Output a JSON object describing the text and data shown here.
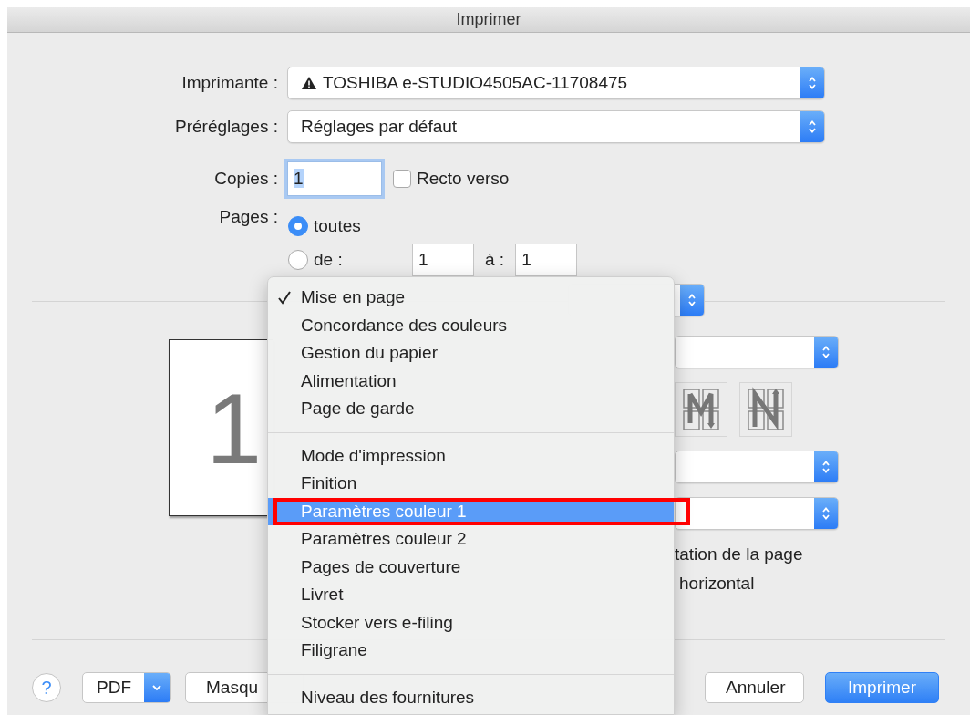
{
  "window": {
    "title": "Imprimer"
  },
  "printer": {
    "label": "Imprimante :",
    "value": "TOSHIBA e-STUDIO4505AC-11708475",
    "warning": true
  },
  "presets": {
    "label": "Préréglages :",
    "value": "Réglages par défaut"
  },
  "copies": {
    "label": "Copies :",
    "value": "1",
    "focused": true
  },
  "duplex": {
    "label": "Recto verso",
    "checked": false
  },
  "pages": {
    "label": "Pages :",
    "options": [
      {
        "label": "toutes",
        "selected": true
      },
      {
        "label": "de :",
        "selected": false
      }
    ],
    "from": "1",
    "to_label": "à :",
    "to": "1"
  },
  "preview": {
    "page_number": "1"
  },
  "settings_panel": {
    "text_1": "tation de la page",
    "text_2": "horizontal"
  },
  "buttons": [
    {
      "label": "?",
      "kind": "help"
    },
    {
      "label": "PDF",
      "kind": "menu"
    },
    {
      "label": "Masqu",
      "kind": "default"
    },
    {
      "label": "Annuler",
      "kind": "default"
    },
    {
      "label": "Imprimer",
      "kind": "primary"
    }
  ],
  "menu": {
    "items": [
      {
        "kind": "item",
        "label": "Mise en page",
        "checked": true,
        "highlighted": false,
        "outlined": false
      },
      {
        "kind": "item",
        "label": "Concordance des couleurs",
        "checked": false,
        "highlighted": false,
        "outlined": false
      },
      {
        "kind": "item",
        "label": "Gestion du papier",
        "checked": false,
        "highlighted": false,
        "outlined": false
      },
      {
        "kind": "item",
        "label": "Alimentation",
        "checked": false,
        "highlighted": false,
        "outlined": false
      },
      {
        "kind": "item",
        "label": "Page de garde",
        "checked": false,
        "highlighted": false,
        "outlined": false
      },
      {
        "kind": "separator"
      },
      {
        "kind": "item",
        "label": "Mode d'impression",
        "checked": false,
        "highlighted": false,
        "outlined": false
      },
      {
        "kind": "item",
        "label": "Finition",
        "checked": false,
        "highlighted": false,
        "outlined": false
      },
      {
        "kind": "item",
        "label": "Paramètres couleur 1",
        "checked": false,
        "highlighted": true,
        "outlined": true
      },
      {
        "kind": "item",
        "label": "Paramètres couleur 2",
        "checked": false,
        "highlighted": false,
        "outlined": false
      },
      {
        "kind": "item",
        "label": "Pages de couverture",
        "checked": false,
        "highlighted": false,
        "outlined": false
      },
      {
        "kind": "item",
        "label": "Livret",
        "checked": false,
        "highlighted": false,
        "outlined": false
      },
      {
        "kind": "item",
        "label": "Stocker vers e-filing",
        "checked": false,
        "highlighted": false,
        "outlined": false
      },
      {
        "kind": "item",
        "label": "Filigrane",
        "checked": false,
        "highlighted": false,
        "outlined": false
      },
      {
        "kind": "separator"
      },
      {
        "kind": "item",
        "label": "Niveau des fournitures",
        "checked": false,
        "highlighted": false,
        "outlined": false
      }
    ]
  }
}
